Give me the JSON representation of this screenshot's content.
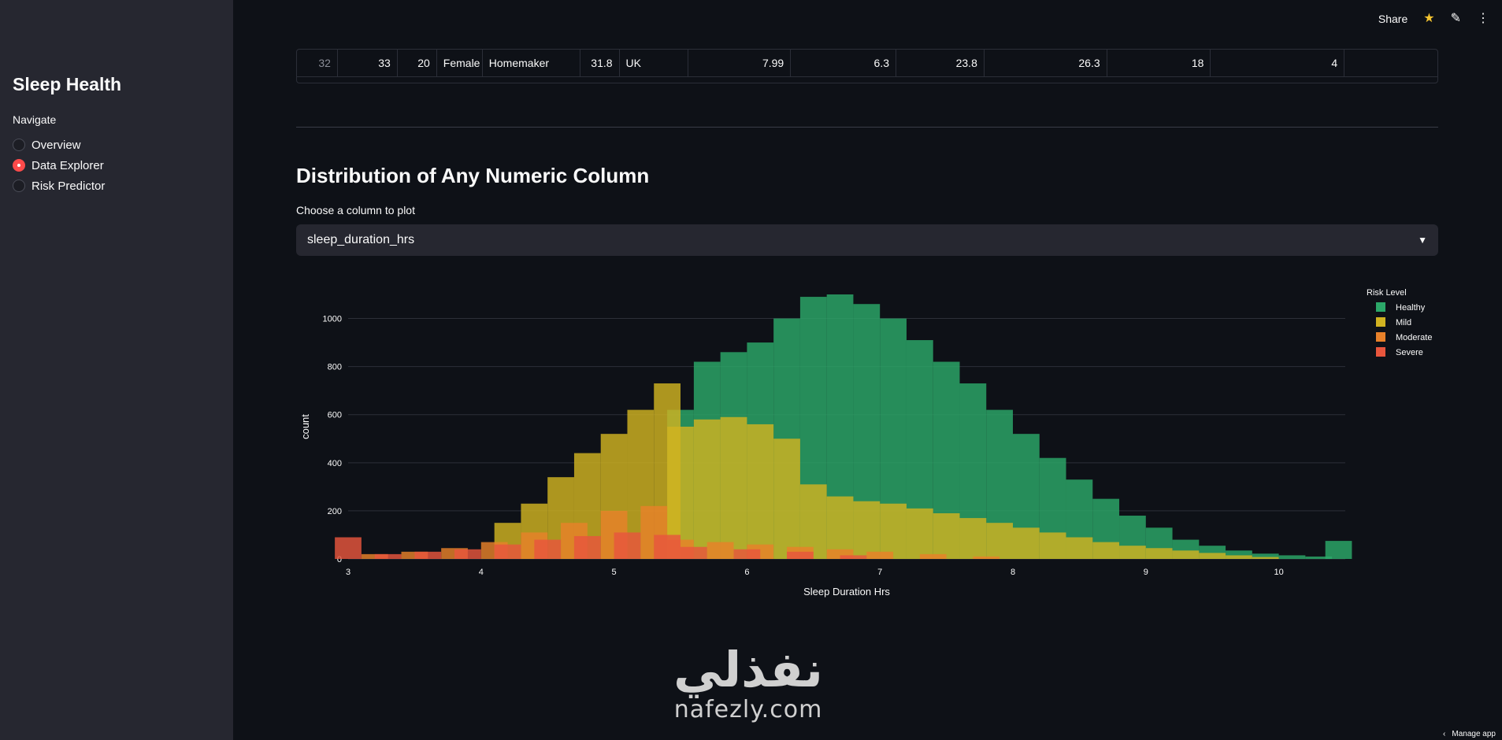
{
  "sidebar": {
    "title": "Sleep Health",
    "nav_label": "Navigate",
    "options": [
      {
        "label": "Overview",
        "selected": false
      },
      {
        "label": "Data Explorer",
        "selected": true
      },
      {
        "label": "Risk Predictor",
        "selected": false
      }
    ]
  },
  "toolbar": {
    "share_label": "Share",
    "icons": [
      "star-icon",
      "edit-icon",
      "more-vert-icon"
    ]
  },
  "table": {
    "row": [
      "32",
      "33",
      "20",
      "Female",
      "Homemaker",
      "31.8",
      "UK",
      "7.99",
      "6.3",
      "23.8",
      "26.3",
      "18",
      "4",
      ""
    ]
  },
  "section": {
    "title": "Distribution of Any Numeric Column",
    "select_label": "Choose a column to plot",
    "select_value": "sleep_duration_hrs"
  },
  "chart_data": {
    "type": "bar",
    "title": "",
    "xlabel": "Sleep Duration Hrs",
    "ylabel": "count",
    "xlim": [
      3,
      10.5
    ],
    "ylim": [
      0,
      1100
    ],
    "x_ticks": [
      3,
      4,
      5,
      6,
      7,
      8,
      9,
      10
    ],
    "y_ticks": [
      0,
      200,
      400,
      600,
      800,
      1000
    ],
    "grid": true,
    "legend_title": "Risk Level",
    "legend_position": "top-right",
    "series": [
      {
        "name": "Healthy",
        "color": "#2ca869",
        "x": [
          5.5,
          5.7,
          5.9,
          6.1,
          6.3,
          6.5,
          6.7,
          6.9,
          7.1,
          7.3,
          7.5,
          7.7,
          7.9,
          8.1,
          8.3,
          8.5,
          8.7,
          8.9,
          9.1,
          9.3,
          9.5,
          9.7,
          9.9,
          10.1,
          10.3,
          10.45
        ],
        "y": [
          620,
          820,
          860,
          900,
          1000,
          1090,
          1100,
          1060,
          1000,
          910,
          820,
          730,
          620,
          520,
          420,
          330,
          250,
          180,
          130,
          80,
          55,
          35,
          22,
          15,
          10,
          75
        ]
      },
      {
        "name": "Mild",
        "color": "#d1b321",
        "x": [
          4.2,
          4.4,
          4.6,
          4.8,
          5.0,
          5.2,
          5.4,
          5.5,
          5.7,
          5.9,
          6.1,
          6.3,
          6.5,
          6.7,
          6.9,
          7.1,
          7.3,
          7.5,
          7.7,
          7.9,
          8.1,
          8.3,
          8.5,
          8.7,
          8.9,
          9.1,
          9.3,
          9.5,
          9.7,
          9.9
        ],
        "y": [
          150,
          230,
          340,
          440,
          520,
          620,
          730,
          550,
          580,
          590,
          560,
          500,
          310,
          260,
          240,
          230,
          210,
          190,
          170,
          150,
          130,
          110,
          90,
          70,
          55,
          45,
          35,
          25,
          15,
          8
        ]
      },
      {
        "name": "Moderate",
        "color": "#e8812a",
        "x": [
          3.2,
          3.5,
          3.8,
          4.1,
          4.4,
          4.7,
          5.0,
          5.3,
          5.5,
          5.8,
          6.1,
          6.4,
          6.7,
          7.0,
          7.4,
          7.8
        ],
        "y": [
          20,
          30,
          45,
          70,
          110,
          150,
          200,
          220,
          80,
          70,
          60,
          50,
          40,
          30,
          20,
          10
        ]
      },
      {
        "name": "Severe",
        "color": "#e8563d",
        "x": [
          3.0,
          3.3,
          3.6,
          3.9,
          4.2,
          4.5,
          4.8,
          5.1,
          5.4,
          5.6,
          6.0,
          6.4,
          6.8
        ],
        "y": [
          90,
          20,
          30,
          40,
          60,
          80,
          95,
          110,
          100,
          50,
          40,
          30,
          15
        ]
      }
    ]
  },
  "watermark": {
    "arabic": "نفذلي",
    "latin": "nafezly.com"
  },
  "footer": {
    "manage_label": "Manage app"
  }
}
